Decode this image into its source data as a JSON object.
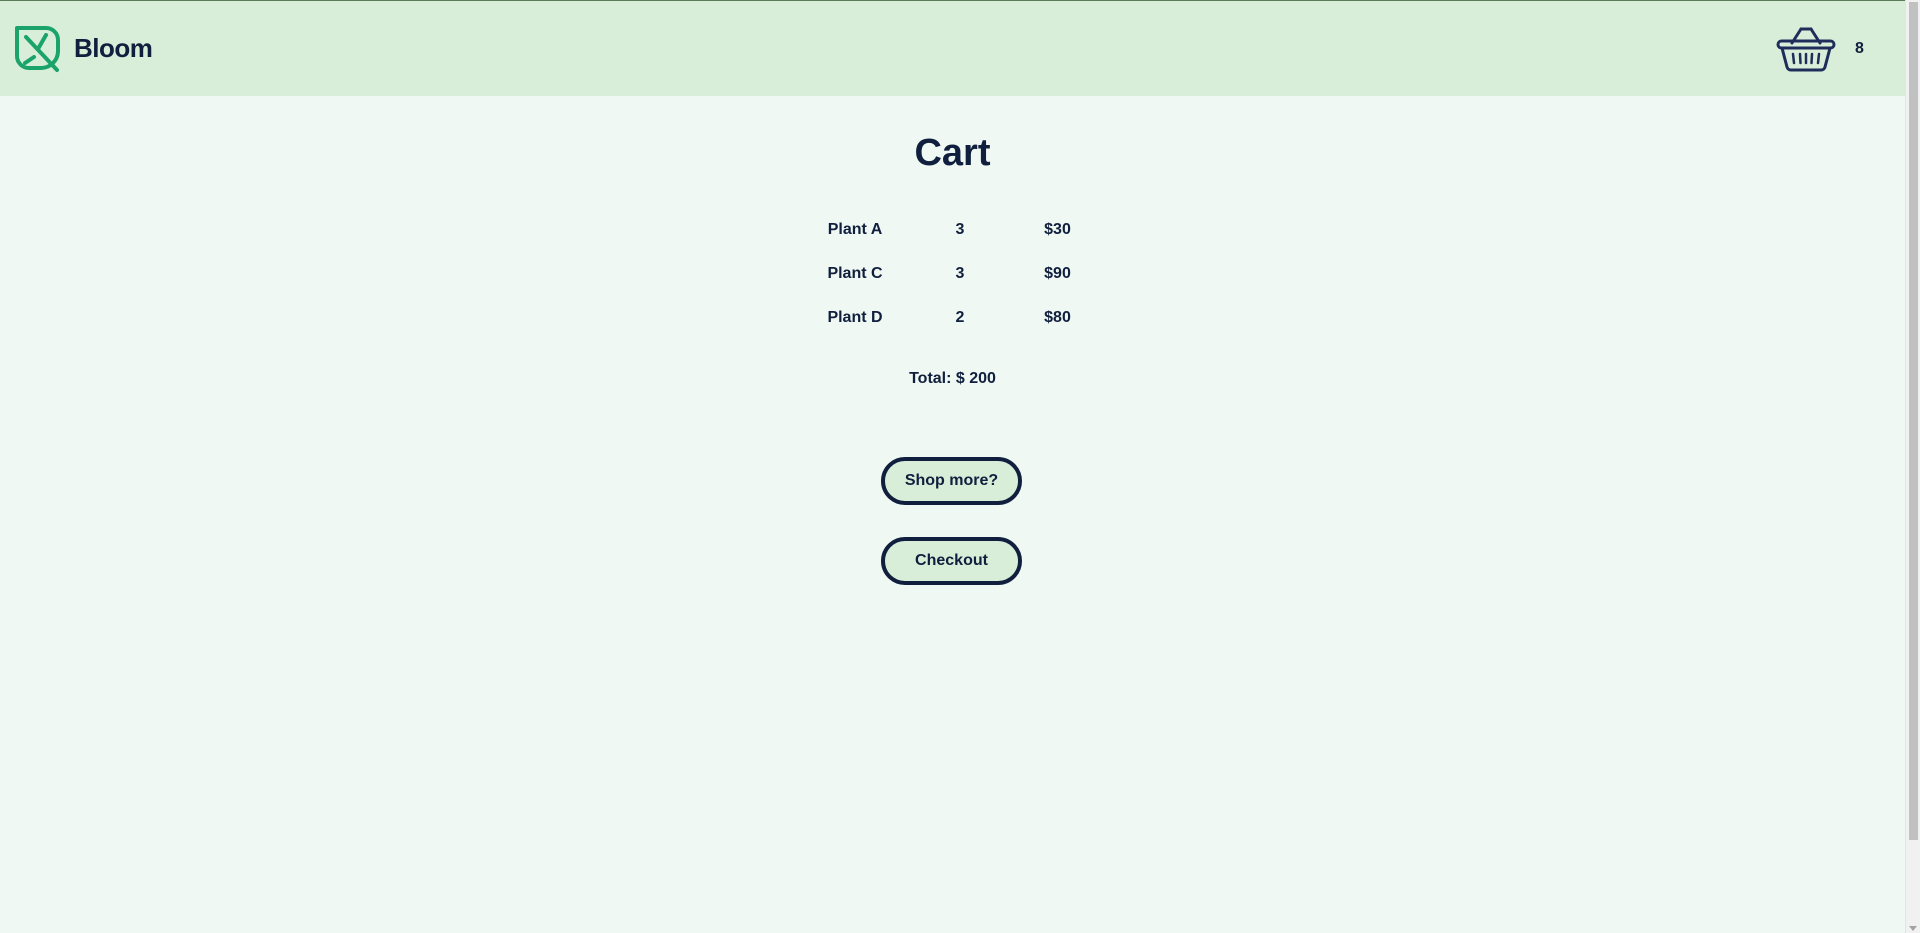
{
  "header": {
    "brand": "Bloom",
    "logo_icon": "leaf-icon",
    "cart_icon": "basket-icon",
    "cart_count": "8"
  },
  "cart": {
    "title": "Cart",
    "items": [
      {
        "name": "Plant A",
        "qty": "3",
        "price": "$30"
      },
      {
        "name": "Plant C",
        "qty": "3",
        "price": "$90"
      },
      {
        "name": "Plant D",
        "qty": "2",
        "price": "$80"
      }
    ],
    "total": "Total: $ 200"
  },
  "actions": {
    "shop_more": "Shop more?",
    "checkout": "Checkout"
  },
  "colors": {
    "header_bg": "#d9eed9",
    "page_bg": "#f0f8f3",
    "text": "#0f1f3d",
    "logo": "#1aa36b"
  }
}
